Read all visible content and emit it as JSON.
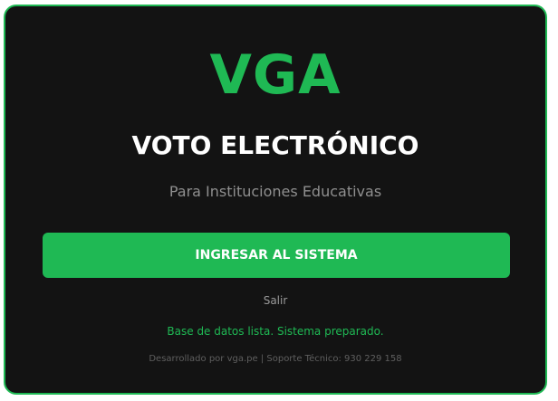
{
  "brand": {
    "logo_text": "VGA",
    "accent_color": "#1fb954"
  },
  "header": {
    "title": "VOTO ELECTRÓNICO",
    "subtitle": "Para Instituciones Educativas"
  },
  "actions": {
    "enter_label": "INGRESAR AL SISTEMA",
    "logout_label": "Salir"
  },
  "status": {
    "message": "Base de datos lista. Sistema preparado."
  },
  "footer": {
    "credits": "Desarrollado por vga.pe | Soporte Técnico: 930 229 158"
  }
}
